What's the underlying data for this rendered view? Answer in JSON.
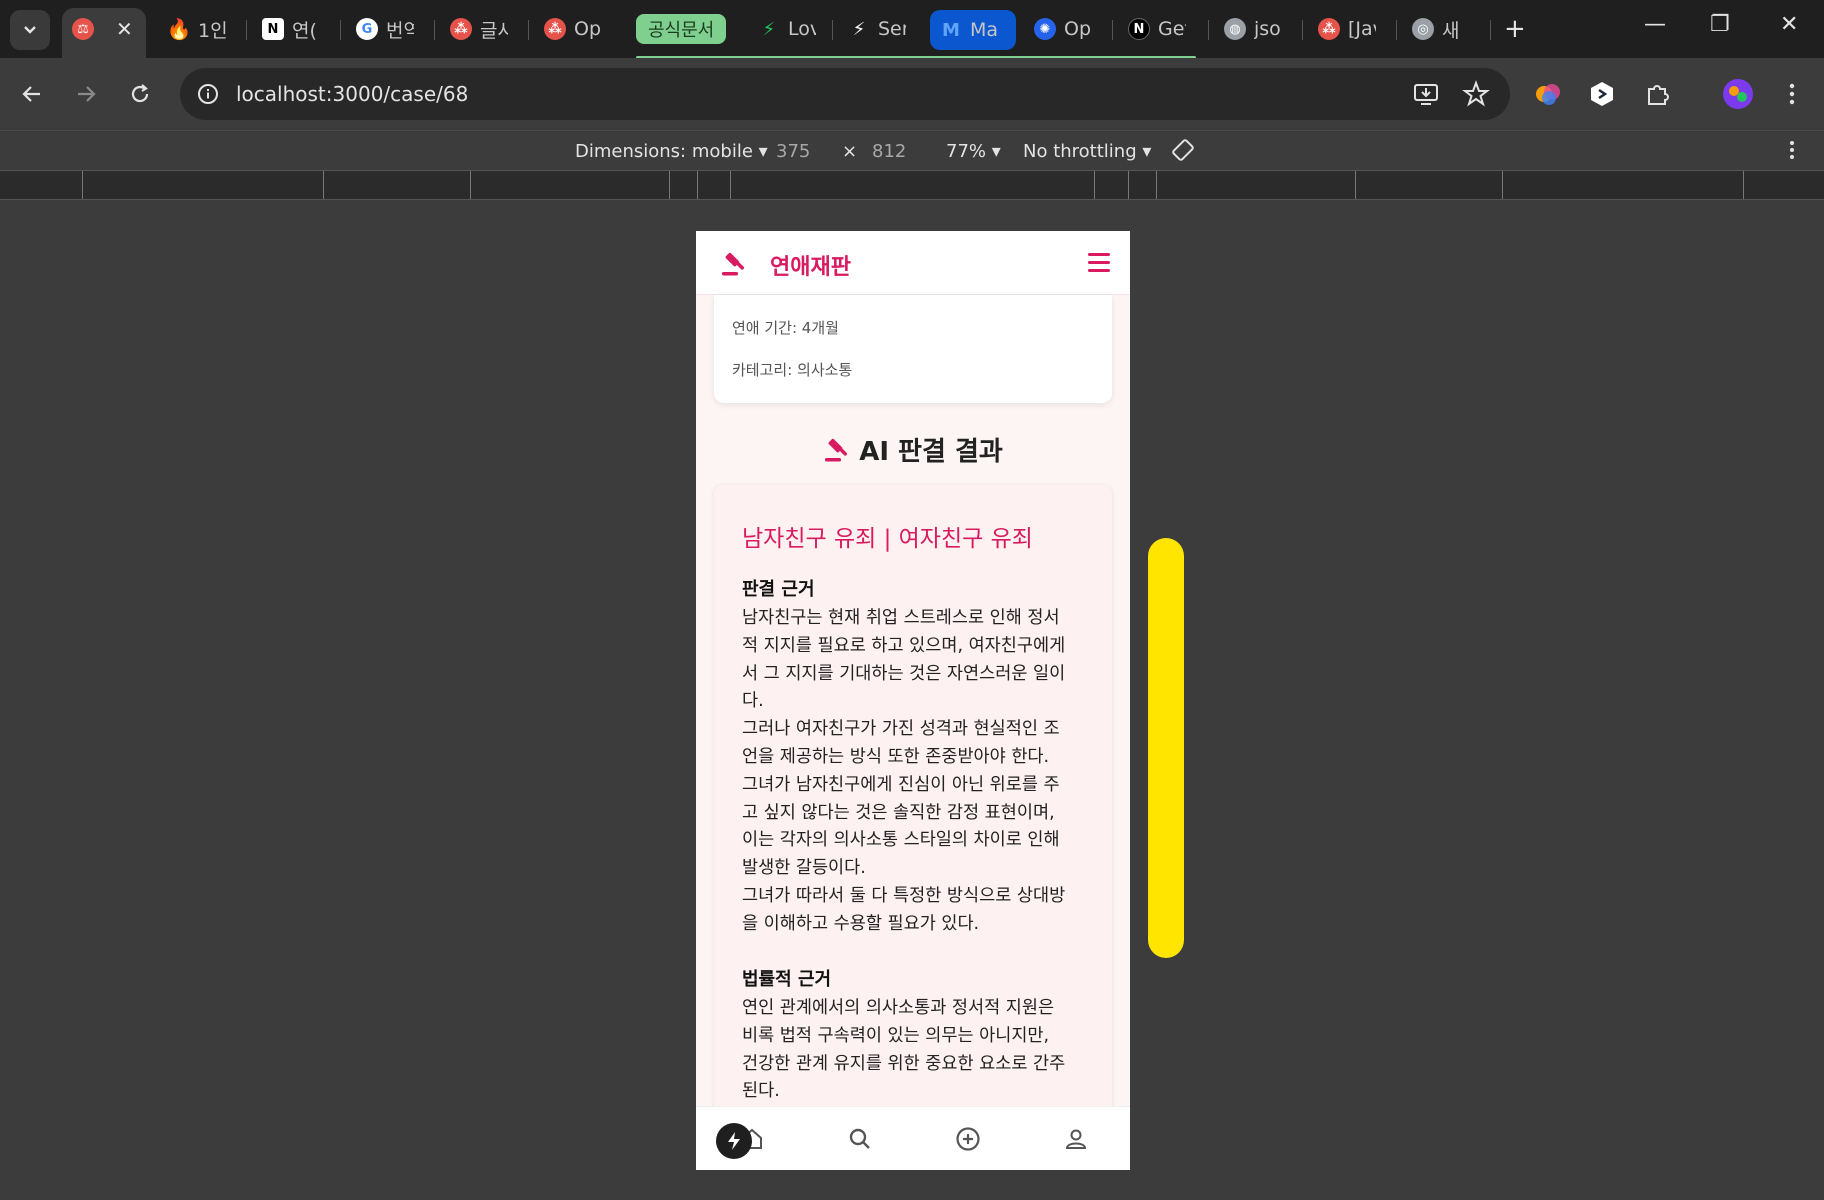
{
  "browser": {
    "tabs": [
      {
        "title": "",
        "icon": "gavel-icon",
        "color": "#e5534b",
        "active": true
      },
      {
        "title": "1인",
        "icon": "fire-icon",
        "color": "#ff7a00"
      },
      {
        "title": "연(",
        "icon": "notion-icon",
        "color": "#ffffff"
      },
      {
        "title": "번역",
        "icon": "google-icon",
        "color": "#4285f4"
      },
      {
        "title": "글사",
        "icon": "app-icon",
        "color": "#e5534b"
      },
      {
        "title": "Op",
        "icon": "app-icon",
        "color": "#e5534b"
      },
      {
        "title": "Lov",
        "icon": "bolt-icon",
        "color": "#22c55e"
      },
      {
        "title": "Ser",
        "icon": "bolt-icon",
        "color": "#ffffff"
      },
      {
        "title": "Ma",
        "icon": "m-logo-icon",
        "color": "#3b82f6",
        "highlight": true
      },
      {
        "title": "Op",
        "icon": "openai-icon",
        "color": "#3b82f6"
      },
      {
        "title": "Get",
        "icon": "n-logo-icon",
        "color": "#ffffff"
      },
      {
        "title": "jso",
        "icon": "globe-icon",
        "color": "#9aa0a6"
      },
      {
        "title": "[Jav",
        "icon": "app-icon",
        "color": "#e5534b"
      },
      {
        "title": "새",
        "icon": "chrome-icon",
        "color": "#9aa0a6"
      }
    ],
    "tab_group_label": "공식문서",
    "close_label": "✕",
    "new_tab_label": "+",
    "url": "localhost:3000/case/68",
    "window_controls": [
      "—",
      "❐",
      "✕"
    ]
  },
  "devtools": {
    "dimensions_label": "Dimensions: mobile",
    "width": "375",
    "times": "×",
    "height": "812",
    "zoom": "77%",
    "throttling": "No throttling"
  },
  "app": {
    "title": "연애재판",
    "accent": "#d81b60",
    "case_info": {
      "period": "연애 기간: 4개월",
      "category": "카테고리: 의사소통"
    },
    "section_title": "AI 판결 결과",
    "verdict": {
      "title": "남자친구 유죄 | 여자친구 유죄",
      "reason_heading": "판결 근거",
      "reason_lines": [
        "남자친구는 현재 취업 스트레스로 인해 정서",
        "적 지지를 필요로 하고 있으며, 여자친구에게",
        "서 그 지지를 기대하는 것은 자연스러운 일이",
        "다.",
        "그러나 여자친구가 가진 성격과 현실적인 조",
        "언을 제공하는 방식 또한 존중받아야 한다.",
        "그녀가 남자친구에게 진심이 아닌 위로를 주",
        "고 싶지 않다는 것은 솔직한 감정 표현이며,",
        "이는 각자의 의사소통 스타일의 차이로 인해",
        "발생한 갈등이다.",
        "그녀가 따라서 둘 다 특정한 방식으로 상대방",
        "을 이해하고 수용할 필요가 있다."
      ],
      "legal_heading": "법률적 근거",
      "legal_lines": [
        "연인 관계에서의 의사소통과 정서적 지원은",
        "비록 법적 구속력이 있는 의무는 아니지만,",
        "건강한 관계 유지를 위한 중요한 요소로 간주",
        "된다."
      ]
    },
    "bottom_nav": [
      "home-icon",
      "search-icon",
      "add-circle-icon",
      "profile-icon"
    ]
  }
}
